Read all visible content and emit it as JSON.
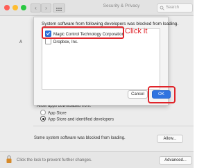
{
  "titlebar": {
    "title": "Security & Privacy",
    "back_glyph": "‹",
    "forward_glyph": "›"
  },
  "search": {
    "placeholder": "Search"
  },
  "dialog": {
    "message": "System software from following developers was blocked from loading.",
    "items": [
      {
        "label": "Magic Control Technology Corporation",
        "checked": true
      },
      {
        "label": "Dropbox, Inc.",
        "checked": false
      }
    ],
    "cancel_label": "Cancel",
    "ok_label": "OK"
  },
  "annotation": {
    "text": "Click it",
    "color": "#e0242a"
  },
  "pane": {
    "obscured_letter": "A",
    "allow_apps_label": "Allow apps downloaded from:",
    "options": [
      {
        "label": "App Store",
        "selected": false
      },
      {
        "label": "App Store and identified developers",
        "selected": true
      }
    ],
    "blocked_message": "Some system software was blocked from loading.",
    "allow_button": "Allow...",
    "lock_text": "Click the lock to prevent further changes.",
    "advanced_button": "Advanced..."
  },
  "colors": {
    "accent": "#2f73e0",
    "annotation_red": "#e0242a",
    "traffic_red": "#ff5f57",
    "traffic_yellow": "#febc2e",
    "traffic_green": "#28c840"
  }
}
